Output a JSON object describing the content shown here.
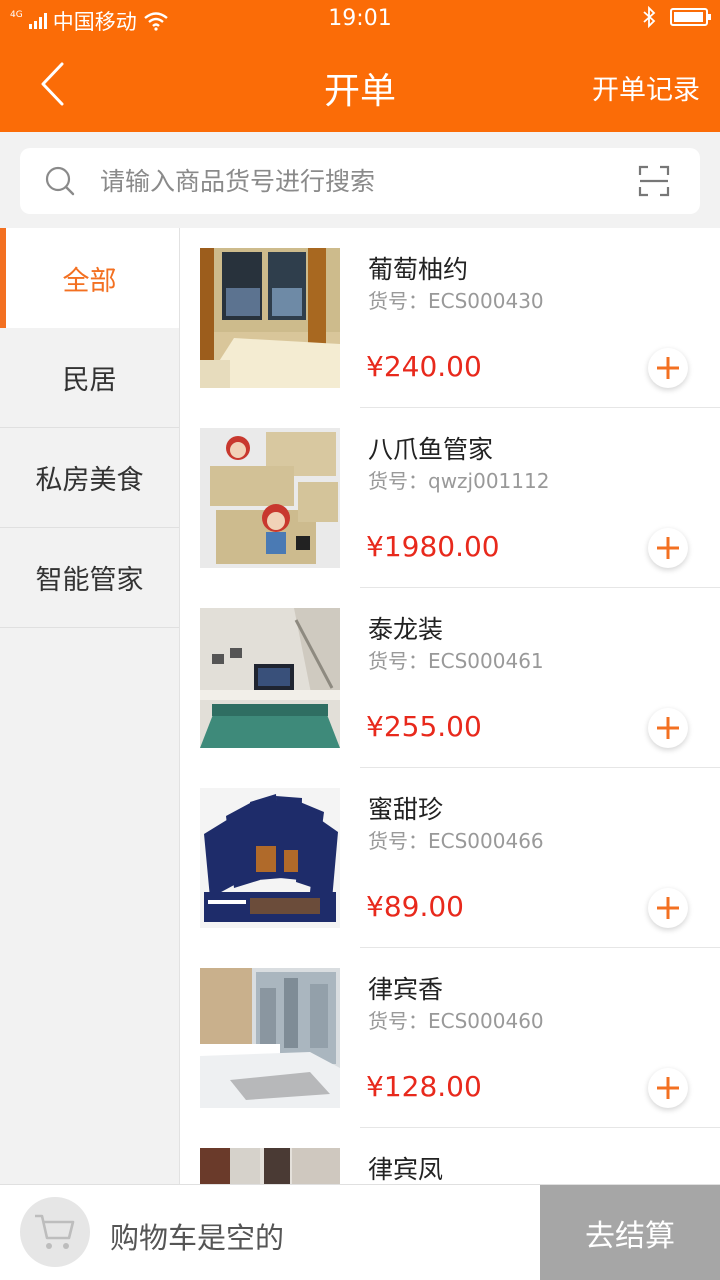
{
  "status_bar": {
    "network": "4G",
    "carrier": "中国移动",
    "time": "19:01",
    "battery_level": 0.85
  },
  "nav": {
    "title": "开单",
    "right_link": "开单记录",
    "back_icon": "chevron-left-icon"
  },
  "search": {
    "placeholder": "请输入商品货号进行搜索",
    "value": "",
    "scan_icon": "scan-icon"
  },
  "categories": [
    {
      "label": "全部",
      "active": true
    },
    {
      "label": "民居",
      "active": false
    },
    {
      "label": "私房美食",
      "active": false
    },
    {
      "label": "智能管家",
      "active": false
    }
  ],
  "products": [
    {
      "name": "葡萄柚约",
      "code": "货号：ECS000430",
      "price": "¥240.00"
    },
    {
      "name": "八爪鱼管家",
      "code": "货号：qwzj001112",
      "price": "¥1980.00"
    },
    {
      "name": "泰龙装",
      "code": "货号：ECS000461",
      "price": "¥255.00"
    },
    {
      "name": "蜜甜珍",
      "code": "货号：ECS000466",
      "price": "¥89.00"
    },
    {
      "name": "律宾香",
      "code": "货号：ECS000460",
      "price": "¥128.00"
    },
    {
      "name": "律宾凤",
      "code": "",
      "price": ""
    }
  ],
  "cart": {
    "empty_text": "购物车是空的",
    "checkout_label": "去结算"
  },
  "colors": {
    "brand": "#fb6c07",
    "price": "#e8291c",
    "active_category": "#f37021",
    "checkout_disabled": "#a6a6a6"
  }
}
